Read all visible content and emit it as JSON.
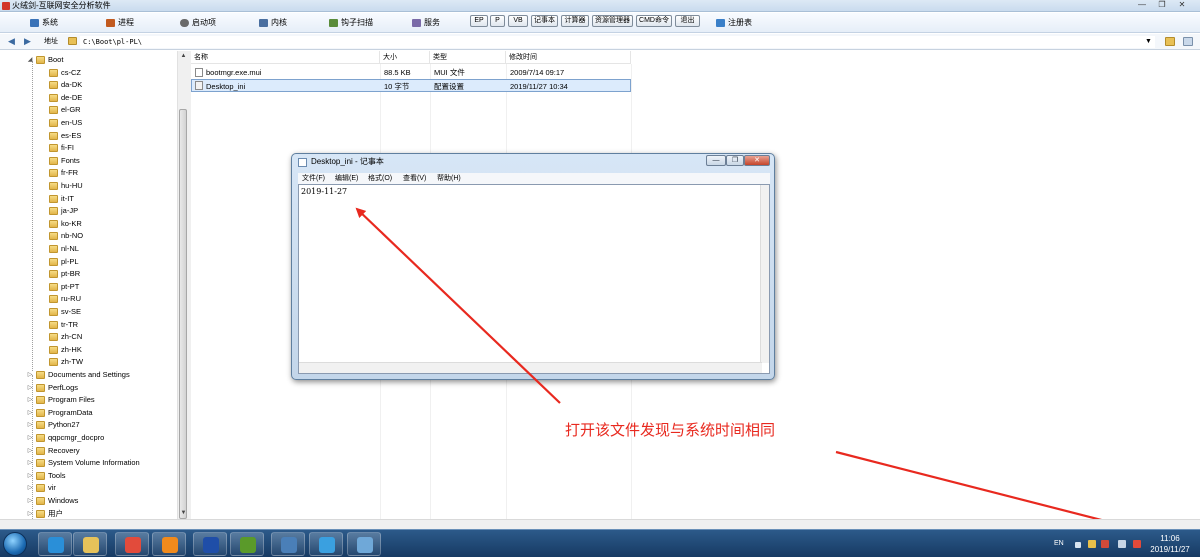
{
  "window": {
    "title": "火绒剑-互联网安全分析软件",
    "min": "—",
    "restore": "❐",
    "close": "✕"
  },
  "menu": {
    "items": [
      {
        "label": "系统",
        "icon": "monitor-icon",
        "color": "#3a73b8"
      },
      {
        "label": "进程",
        "icon": "process-icon",
        "color": "#c25a1f"
      },
      {
        "label": "启动项",
        "icon": "gear-icon",
        "color": "#6a6a6a"
      },
      {
        "label": "内核",
        "icon": "kernel-icon",
        "color": "#4a6fa0"
      },
      {
        "label": "钩子扫描",
        "icon": "hook-icon",
        "color": "#5a8c3a"
      },
      {
        "label": "服务",
        "icon": "service-icon",
        "color": "#7a6aa8"
      }
    ],
    "tools": [
      "EP",
      "P",
      "VB",
      "记事本",
      "计算器",
      "资源管理器",
      "CMD命令",
      "退出"
    ],
    "registry": {
      "label": "注册表",
      "icon": "registry-icon",
      "color": "#3a7fc8"
    }
  },
  "address": {
    "label": "地址",
    "value": "C:\\Boot\\pl-PL\\",
    "dropdown": "▼"
  },
  "tree": {
    "root": "Boot",
    "children": [
      "cs-CZ",
      "da-DK",
      "de-DE",
      "el-GR",
      "en-US",
      "es-ES",
      "fi-FI",
      "Fonts",
      "fr-FR",
      "hu-HU",
      "it-IT",
      "ja-JP",
      "ko-KR",
      "nb-NO",
      "nl-NL",
      "pl-PL",
      "pt-BR",
      "pt-PT",
      "ru-RU",
      "sv-SE",
      "tr-TR",
      "zh-CN",
      "zh-HK",
      "zh-TW"
    ],
    "siblings": [
      "Documents and Settings",
      "PerfLogs",
      "Program Files",
      "ProgramData",
      "Python27",
      "qqpcmgr_docpro",
      "Recovery",
      "System Volume Information",
      "Tools",
      "vir",
      "Windows",
      "用户"
    ]
  },
  "list": {
    "columns": [
      "名称",
      "大小",
      "类型",
      "修改时间"
    ],
    "rows": [
      {
        "name": "bootmgr.exe.mui",
        "size": "88.5 KB",
        "type": "MUI 文件",
        "modified": "2009/7/14 09:17"
      },
      {
        "name": "Desktop_ini",
        "size": "10 字节",
        "type": "配置设置",
        "modified": "2019/11/27 10:34"
      }
    ]
  },
  "notepad": {
    "title": "Desktop_ini - 记事本",
    "menu": [
      "文件(F)",
      "编辑(E)",
      "格式(O)",
      "查看(V)",
      "帮助(H)"
    ],
    "content": "2019-11-27",
    "min": "—",
    "restore": "❐",
    "close": "✕"
  },
  "annotation": {
    "text": "打开该文件发现与系统时间相同",
    "color": "#e8291f"
  },
  "taskbar": {
    "apps": [
      {
        "name": "ie-icon",
        "color": "#2a8fd8"
      },
      {
        "name": "explorer-icon",
        "color": "#e6c25a"
      },
      {
        "name": "chrome-icon",
        "color": "#e24b3b"
      },
      {
        "name": "firefox-icon",
        "color": "#f08a1c"
      },
      {
        "name": "b-app-icon",
        "color": "#1f4ea8"
      },
      {
        "name": "puzzle-app-icon",
        "color": "#5a9a2a"
      },
      {
        "name": "remote-desktop-icon",
        "color": "#4a7fb8"
      },
      {
        "name": "network-app-icon",
        "color": "#3aa0e0"
      },
      {
        "name": "tool-app-icon",
        "color": "#6fa8d8"
      }
    ],
    "lang": "EN",
    "time": "11:06",
    "date": "2019/11/27"
  }
}
